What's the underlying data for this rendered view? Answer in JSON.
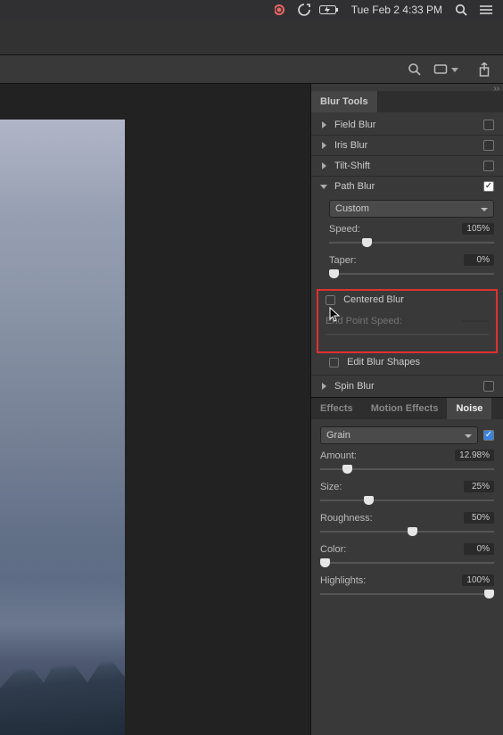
{
  "menubar": {
    "datetime": "Tue Feb 2  4:33 PM"
  },
  "blur_panel": {
    "title": "Blur Tools",
    "items": {
      "field": "Field Blur",
      "iris": "Iris Blur",
      "tilt": "Tilt-Shift",
      "path": "Path Blur",
      "spin": "Spin Blur"
    },
    "path_controls": {
      "mode": "Custom",
      "speed_label": "Speed:",
      "speed_value": "105%",
      "taper_label": "Taper:",
      "taper_value": "0%",
      "centered_label": "Centered Blur",
      "endpoint_label": "End Point Speed:",
      "edit_shapes_label": "Edit Blur Shapes"
    }
  },
  "lower_tabs": {
    "effects": "Effects",
    "motion": "Motion Effects",
    "noise": "Noise"
  },
  "noise": {
    "mode": "Grain",
    "amount_label": "Amount:",
    "amount_value": "12.98%",
    "size_label": "Size:",
    "size_value": "25%",
    "rough_label": "Roughness:",
    "rough_value": "50%",
    "color_label": "Color:",
    "color_value": "0%",
    "high_label": "Highlights:",
    "high_value": "100%"
  }
}
